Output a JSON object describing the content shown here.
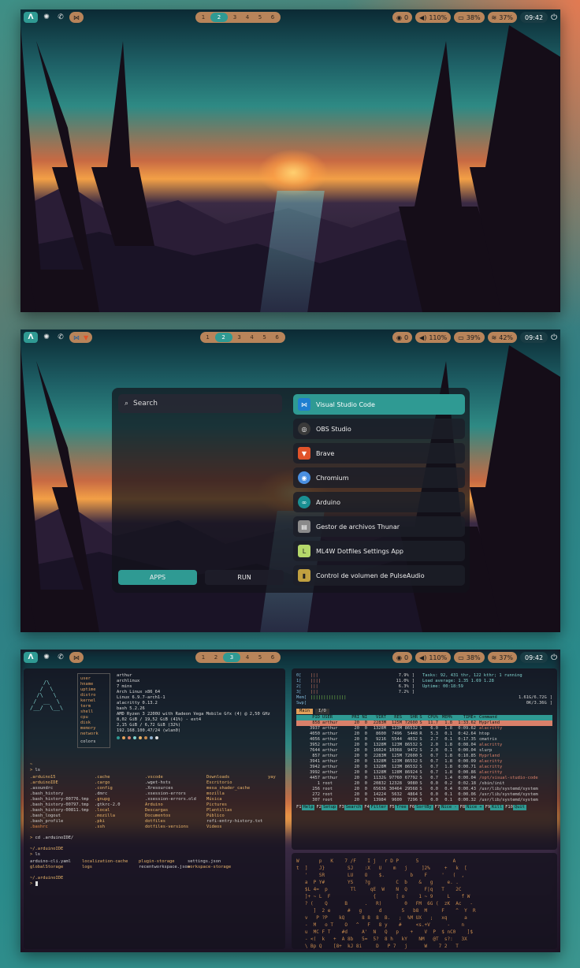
{
  "topbar1": {
    "workspaces": [
      "1",
      "2",
      "3",
      "4",
      "5",
      "6"
    ],
    "active": "2",
    "notif": "0",
    "volume": "110%",
    "battery": "38%",
    "wifi": "37%",
    "clock": "09:42"
  },
  "topbar2": {
    "workspaces": [
      "1",
      "2",
      "3",
      "4",
      "5",
      "6"
    ],
    "active": "2",
    "notif": "0",
    "volume": "110%",
    "battery": "39%",
    "wifi": "42%",
    "clock": "09:41"
  },
  "topbar3": {
    "workspaces": [
      "1",
      "2",
      "3",
      "4",
      "5",
      "6"
    ],
    "active": "3",
    "notif": "0",
    "volume": "110%",
    "battery": "38%",
    "wifi": "37%",
    "clock": "09:42"
  },
  "launcher": {
    "search_placeholder": "Search",
    "modes": [
      "APPS",
      "RUN"
    ],
    "apps": [
      {
        "name": "Visual Studio Code",
        "icon": "vscode-icon",
        "color": "#1f7fd0"
      },
      {
        "name": "OBS Studio",
        "icon": "obs-icon",
        "color": "#3a3a3a"
      },
      {
        "name": "Brave",
        "icon": "brave-icon",
        "color": "#e0532a"
      },
      {
        "name": "Chromium",
        "icon": "chromium-icon",
        "color": "#4a8fe0"
      },
      {
        "name": "Arduino",
        "icon": "arduino-icon",
        "color": "#1a8f92"
      },
      {
        "name": "Gestor de archivos Thunar",
        "icon": "thunar-icon",
        "color": "#8a8a8a"
      },
      {
        "name": "ML4W Dotfiles Settings App",
        "icon": "ml4w-icon",
        "color": "#b5d86a"
      },
      {
        "name": "Control de volumen de PulseAudio",
        "icon": "pulseaudio-icon",
        "color": "#c0a040"
      }
    ]
  },
  "fastfetch": {
    "keys": [
      "user",
      "hname",
      "uptime",
      "distro",
      "kernel",
      "term",
      "shell",
      "cpu",
      "disk",
      "memory",
      "network"
    ],
    "values": [
      "arthur",
      "archlinux",
      "7 mins",
      "Arch Linux x86_64",
      "Linux 6.9.7-arch1-1",
      "alacritty 0.13.2",
      "bash 5.2.26",
      "AMD Ryzen 3 2200U with Radeon Vega Mobile Gfx (4) @ 2,50 GHz",
      "8,02 GiB / 19,52 GiB (41%) - ext4",
      "2,15 GiB / 6,72 GiB (32%)",
      "192.168.100.47/24 (wlan0)"
    ],
    "colors_label": "colors"
  },
  "ls1": {
    "cmd": "ls",
    "items": [
      [
        ".arduino15",
        ".cache",
        ".vscode",
        "Downloads",
        "yay"
      ],
      [
        ".arduinoIDE",
        ".cargo",
        ".wget-hsts",
        "Escritorio",
        ""
      ],
      [
        ".asoundrc",
        ".config",
        ".Xresources",
        "mesa_shader_cache",
        ""
      ],
      [
        ".bash_history",
        ".dmrc",
        ".xsession-errors",
        "mozilla",
        ""
      ],
      [
        ".bash_history-00776.tmp",
        ".gnupg",
        ".xsession-errors.old",
        "Música",
        ""
      ],
      [
        ".bash_history-00797.tmp",
        ".gtkrc-2.0",
        "Arduino",
        "Pictures",
        ""
      ],
      [
        ".bash_history-00811.tmp",
        ".local",
        "Descargas",
        "Plantillas",
        ""
      ],
      [
        ".bash_logout",
        ".mozilla",
        "Documentos",
        "Público",
        ""
      ],
      [
        ".bash_profile",
        ".pki",
        "dotfiles",
        "rofi-entry-history.txt",
        ""
      ],
      [
        ".bashrc",
        ".ssh",
        "dotfiles-versions",
        "Videos",
        ""
      ]
    ]
  },
  "cd_cmd": "cd .arduinoIDE/",
  "path2": "~/.arduinoIDE",
  "ls2": [
    "arduino-cli.yaml",
    "localization-cache",
    "plugin-storage",
    "settings.json",
    "globalStorage",
    "logs",
    "recentworkspace.json",
    "workspace-storage"
  ],
  "htop": {
    "summary": [
      "Tasks: 92, 431 thr, 122 kthr; 1 running",
      "Load average: 1.35 1.69 1.28",
      "Uptime: 00:18:59"
    ],
    "cpu_pct": [
      "7.9%",
      "11.0%",
      "6.3%",
      "7.2%"
    ],
    "mem": "1.61G/6.72G",
    "swp": "0K/3.36G",
    "tabs": [
      "Main",
      "I/O"
    ],
    "header": [
      "PID",
      "USER",
      "PRI",
      "NI",
      "VIRT",
      "RES",
      "SHR",
      "S",
      "CPU%",
      "MEM%",
      "TIME+",
      "Command"
    ],
    "rows": [
      [
        "858",
        "arthur",
        "20",
        "0",
        "2283M",
        "125M",
        "72600",
        "S",
        "11.7",
        "1.8",
        "1:33.62",
        "Hyprland"
      ],
      [
        "3937",
        "arthur",
        "20",
        "0",
        "1328M",
        "123M",
        "86532",
        "S",
        "6.0",
        "1.8",
        "0:09.62",
        "alacritty"
      ],
      [
        "4050",
        "arthur",
        "20",
        "0",
        "8600",
        "7496",
        "5448",
        "R",
        "5.3",
        "0.1",
        "0:42.64",
        "htop"
      ],
      [
        "4056",
        "arthur",
        "20",
        "0",
        "9216",
        "5544",
        "4032",
        "S",
        "2.7",
        "0.1",
        "0:17.35",
        "cmatrix"
      ],
      [
        "3952",
        "arthur",
        "20",
        "0",
        "1328M",
        "123M",
        "86532",
        "S",
        "2.0",
        "1.8",
        "0:08.04",
        "alacritty"
      ],
      [
        "7644",
        "arthur",
        "20",
        "0",
        "16024",
        "10368",
        "9472",
        "S",
        "2.0",
        "0.1",
        "0:00.04",
        "slurp"
      ],
      [
        "857",
        "arthur",
        "20",
        "0",
        "2283M",
        "125M",
        "72600",
        "S",
        "0.7",
        "1.8",
        "0:10.85",
        "Hyprland"
      ],
      [
        "3941",
        "arthur",
        "20",
        "0",
        "1328M",
        "123M",
        "86532",
        "S",
        "0.7",
        "1.8",
        "0:00.09",
        "alacritty"
      ],
      [
        "3942",
        "arthur",
        "20",
        "0",
        "1328M",
        "123M",
        "86532",
        "S",
        "0.7",
        "1.8",
        "0:00.71",
        "alacritty"
      ],
      [
        "3992",
        "arthur",
        "20",
        "0",
        "1328M",
        "128M",
        "86924",
        "S",
        "0.7",
        "1.8",
        "0:00.86",
        "alacritty"
      ],
      [
        "4457",
        "arthur",
        "20",
        "0",
        "1132G",
        "97760",
        "67792",
        "S",
        "0.7",
        "1.4",
        "0:00.04",
        "/opt/visual-studio-code"
      ],
      [
        "1",
        "root",
        "20",
        "0",
        "20832",
        "12328",
        "9080",
        "S",
        "0.0",
        "0.2",
        "0:02.18",
        "/sbin/init"
      ],
      [
        "256",
        "root",
        "20",
        "0",
        "65636",
        "30464",
        "29568",
        "S",
        "0.0",
        "0.4",
        "0:00.43",
        "/usr/lib/systemd/system"
      ],
      [
        "272",
        "root",
        "20",
        "0",
        "14224",
        "5632",
        "4864",
        "S",
        "0.0",
        "0.1",
        "0:00.06",
        "/usr/lib/systemd/system"
      ],
      [
        "307",
        "root",
        "20",
        "0",
        "13984",
        "9600",
        "7296",
        "S",
        "0.0",
        "0.1",
        "0:00.32",
        "/usr/lib/systemd/system"
      ]
    ],
    "fkeys": [
      [
        "F1",
        "Help"
      ],
      [
        "F2",
        "Setup"
      ],
      [
        "F3",
        "Search"
      ],
      [
        "F4",
        "Filter"
      ],
      [
        "F5",
        "Tree"
      ],
      [
        "F6",
        "SortBy"
      ],
      [
        "F7",
        "Nice -"
      ],
      [
        "F8",
        "Nice +"
      ],
      [
        "F9",
        "Kill"
      ],
      [
        "F10",
        "Quit"
      ]
    ]
  },
  "cmatrix": [
    "W       p   K    7 /F    I j   r D P      5            A",
    "t  ]    J}        SJ    :X   U    m   j     ]2%     +   k  [",
    "   '    SR        LU    O    $.         b    F     '   (  ,",
    "   a  P Y#        YS    ?g         C  b    &   g     e. .",
    "   $L 4=  p        Tl     qE  W    N  Q      F|q   T    2C",
    "   ]+ ~ L  F               {       [ o     1 ~ 9     L    f W",
    "   ? (    Q      B      .   R)        0   FM  6G (  zK  Ac   -",
    "      ]  2 e      #   g      d       5   b8  M     F    ^  Y  R",
    "   v   P ?P    kQ      8 8  8  B.   ;  %M UX   ;   xq      a",
    "   -  M   o T    O   ^   F   8 y    #     <s.+V      -    n",
    "   u  MC F T    #d     A'  N   Q   p    +    V  P  $ nC0    ]$",
    "   - <(  k   +  A 8b   5=  5?  8 h   kY    NM   @T  s?:   3X",
    "   \\ Bp Q    [8+  kJ 8i     D   P 7   j      W    7 2   T"
  ],
  "colors": {
    "accent": "#2f9a93",
    "bar_pill": "#b8845a",
    "terminal_bg": "#16121e",
    "selected_row": "#d9806a"
  }
}
